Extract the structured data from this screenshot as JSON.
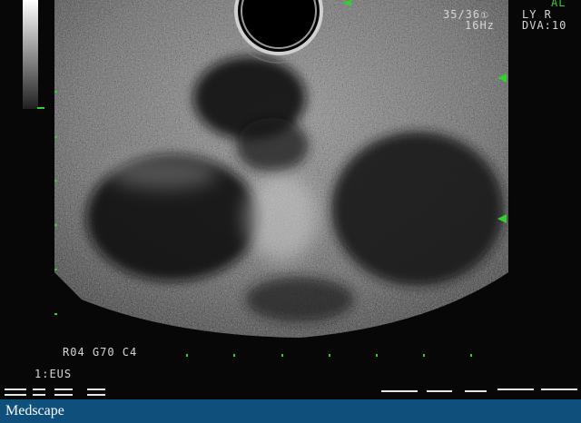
{
  "overlay": {
    "frame": "35/36",
    "frame_mark": "①",
    "rate": "16Hz",
    "orientation": "LY R",
    "dva": "DVA:10",
    "corner_partial": "AL",
    "settings": "R04 G70 C4",
    "mode": "1:EUS"
  },
  "footer": {
    "brand": "Medscape"
  },
  "colors": {
    "accent": "#2fd12f",
    "footer_bg": "#0f4f7b",
    "text": "#d6d6d6"
  },
  "image": {
    "subject": "endoscopic ultrasound (EUS) sector scan"
  }
}
